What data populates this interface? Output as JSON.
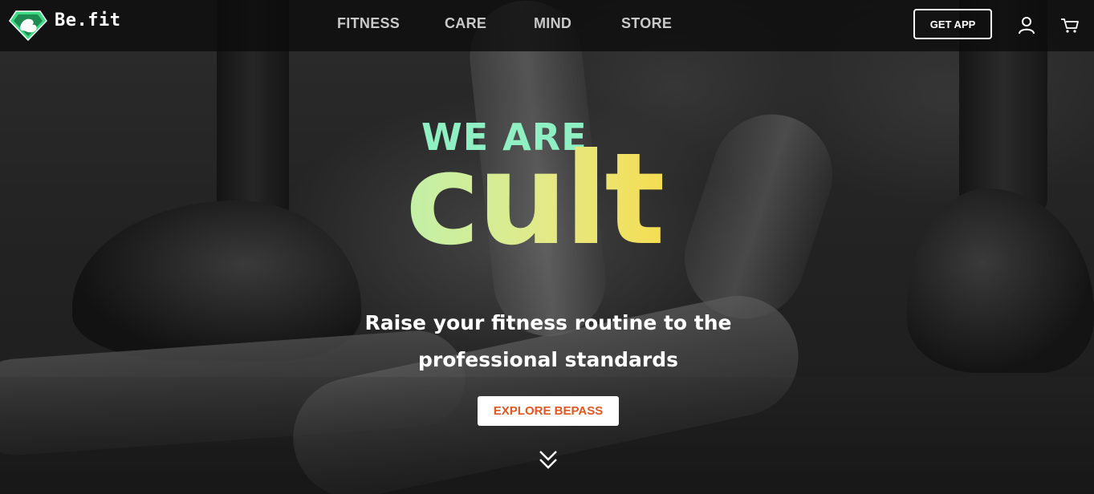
{
  "navbar": {
    "brand": "Be.fit",
    "links": [
      "FITNESS",
      "CARE",
      "MIND",
      "STORE"
    ],
    "get_app": "GET APP",
    "icons": {
      "logo": "flexing-arm-diamond-logo",
      "account": "user-icon",
      "cart": "cart-icon"
    }
  },
  "hero": {
    "headline_top": "WE ARE",
    "headline_big": "cult",
    "subheadline": "Raise your fitness routine to the professional standards",
    "cta": "EXPLORE BEPASS",
    "scroll_icon": "double-chevron-down-icon"
  },
  "colors": {
    "accent_green": "#8ff0c4",
    "gradient_start": "#c2f0a8",
    "gradient_end": "#f5dd52",
    "cta_text": "#e2561f",
    "logo_green": "#3ddc84"
  }
}
